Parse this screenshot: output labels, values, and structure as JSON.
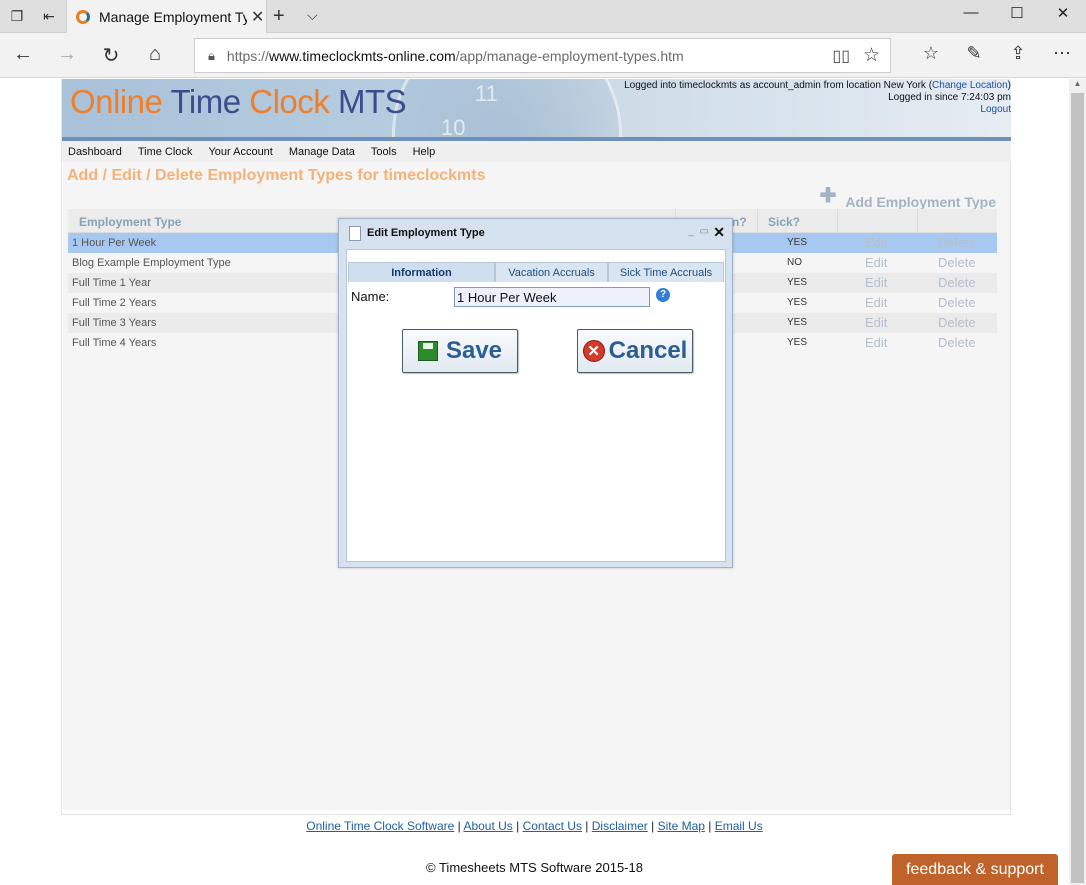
{
  "browser": {
    "tab_title": "Manage Employment Ty",
    "url_prefix": "https://",
    "url_domain": "www.timeclockmts-online.com",
    "url_path": "/app/manage-employment-types.htm"
  },
  "header": {
    "logo_online": "Online",
    "logo_time": "Time",
    "logo_clock": "Clock",
    "logo_mts": "MTS",
    "login_line": "Logged into timeclockmts as account_admin from location New York (",
    "change_location": "Change Location",
    "login_close": ")",
    "logged_since": "Logged in since 7:24:03 pm",
    "logout": "Logout"
  },
  "menu": [
    "Dashboard",
    "Time Clock",
    "Your Account",
    "Manage Data",
    "Tools",
    "Help"
  ],
  "page": {
    "title": "Add / Edit / Delete Employment Types for timeclockmts",
    "add_label": "Add Employment Type"
  },
  "grid": {
    "col_type": "Employment Type",
    "col_vacation": "n?",
    "col_sick": "Sick?",
    "edit_label": "Edit",
    "delete_label": "Delete",
    "rows": [
      {
        "name": "1 Hour Per Week",
        "sick": "YES"
      },
      {
        "name": "Blog Example Employment Type",
        "sick": "NO"
      },
      {
        "name": "Full Time 1 Year",
        "sick": "YES"
      },
      {
        "name": "Full Time 2 Years",
        "sick": "YES"
      },
      {
        "name": "Full Time 3 Years",
        "sick": "YES"
      },
      {
        "name": "Full Time 4 Years",
        "sick": "YES"
      }
    ]
  },
  "modal": {
    "title": "Edit Employment Type",
    "tabs": [
      "Information",
      "Vacation Accruals",
      "Sick Time Accruals"
    ],
    "name_label": "Name:",
    "name_value": "1 Hour Per Week",
    "save_label": "Save",
    "cancel_label": "Cancel"
  },
  "footer": {
    "links": [
      "Online Time Clock Software",
      "About Us",
      "Contact Us",
      "Disclaimer",
      "Site Map",
      "Email Us"
    ],
    "copyright": "© Timesheets MTS Software 2015-18",
    "feedback": "feedback & support"
  }
}
